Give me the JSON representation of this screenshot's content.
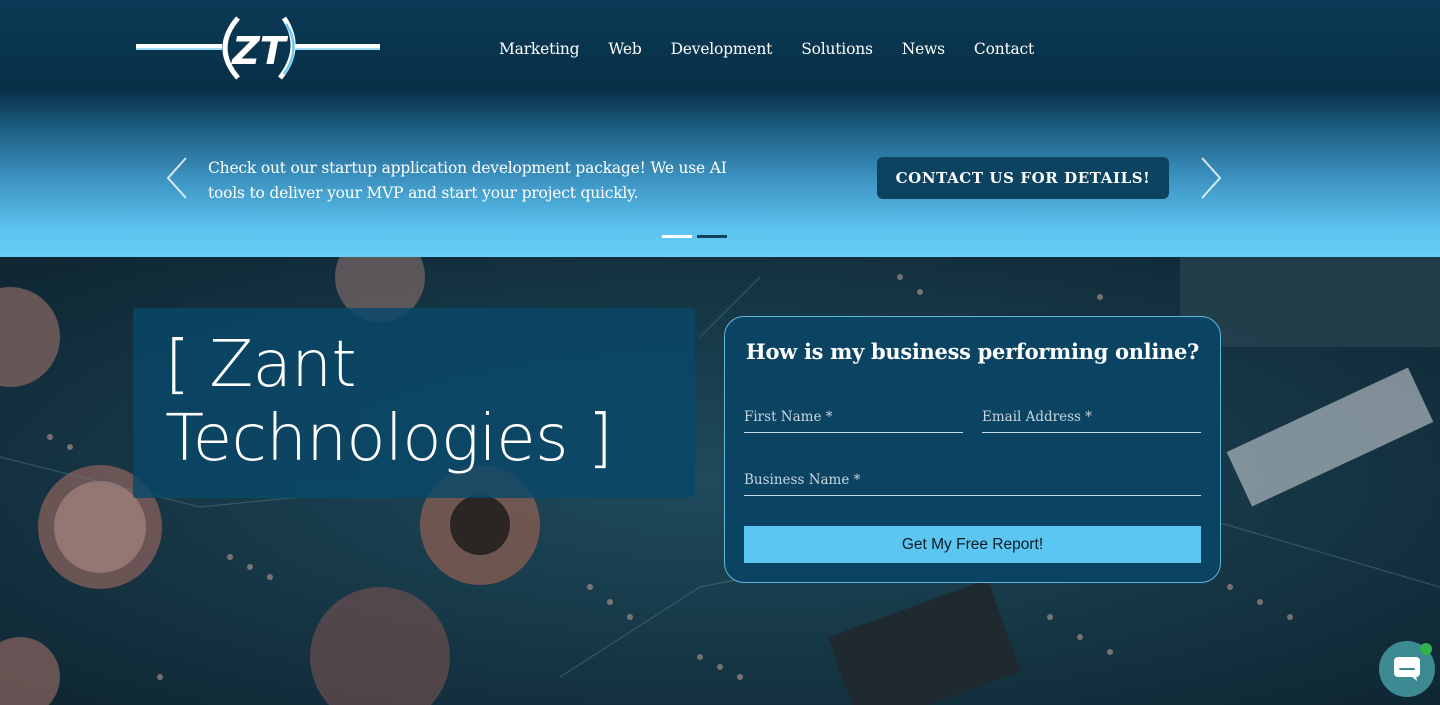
{
  "brand": {
    "logo_text": "ZT"
  },
  "nav": {
    "items": [
      "Marketing",
      "Web",
      "Development",
      "Solutions",
      "News",
      "Contact"
    ]
  },
  "promo": {
    "text": "Check out our startup application development package! We use AI tools to deliver your MVP and start your project quickly.",
    "button_label": "CONTACT US FOR DETAILS!",
    "slide_count": 2,
    "active_slide": 1
  },
  "hero": {
    "title": "[ Zant Technologies ]"
  },
  "form": {
    "heading": "How is my business performing online?",
    "first_name_placeholder": "First Name *",
    "email_placeholder": "Email Address *",
    "business_placeholder": "Business Name *",
    "submit_label": "Get My Free Report!"
  },
  "colors": {
    "header_dark": "#083047",
    "promo_light": "#68cdf4",
    "button_dark": "#0b4360",
    "submit_blue": "#5cc6f2",
    "chat_teal": "#3e8a93"
  }
}
